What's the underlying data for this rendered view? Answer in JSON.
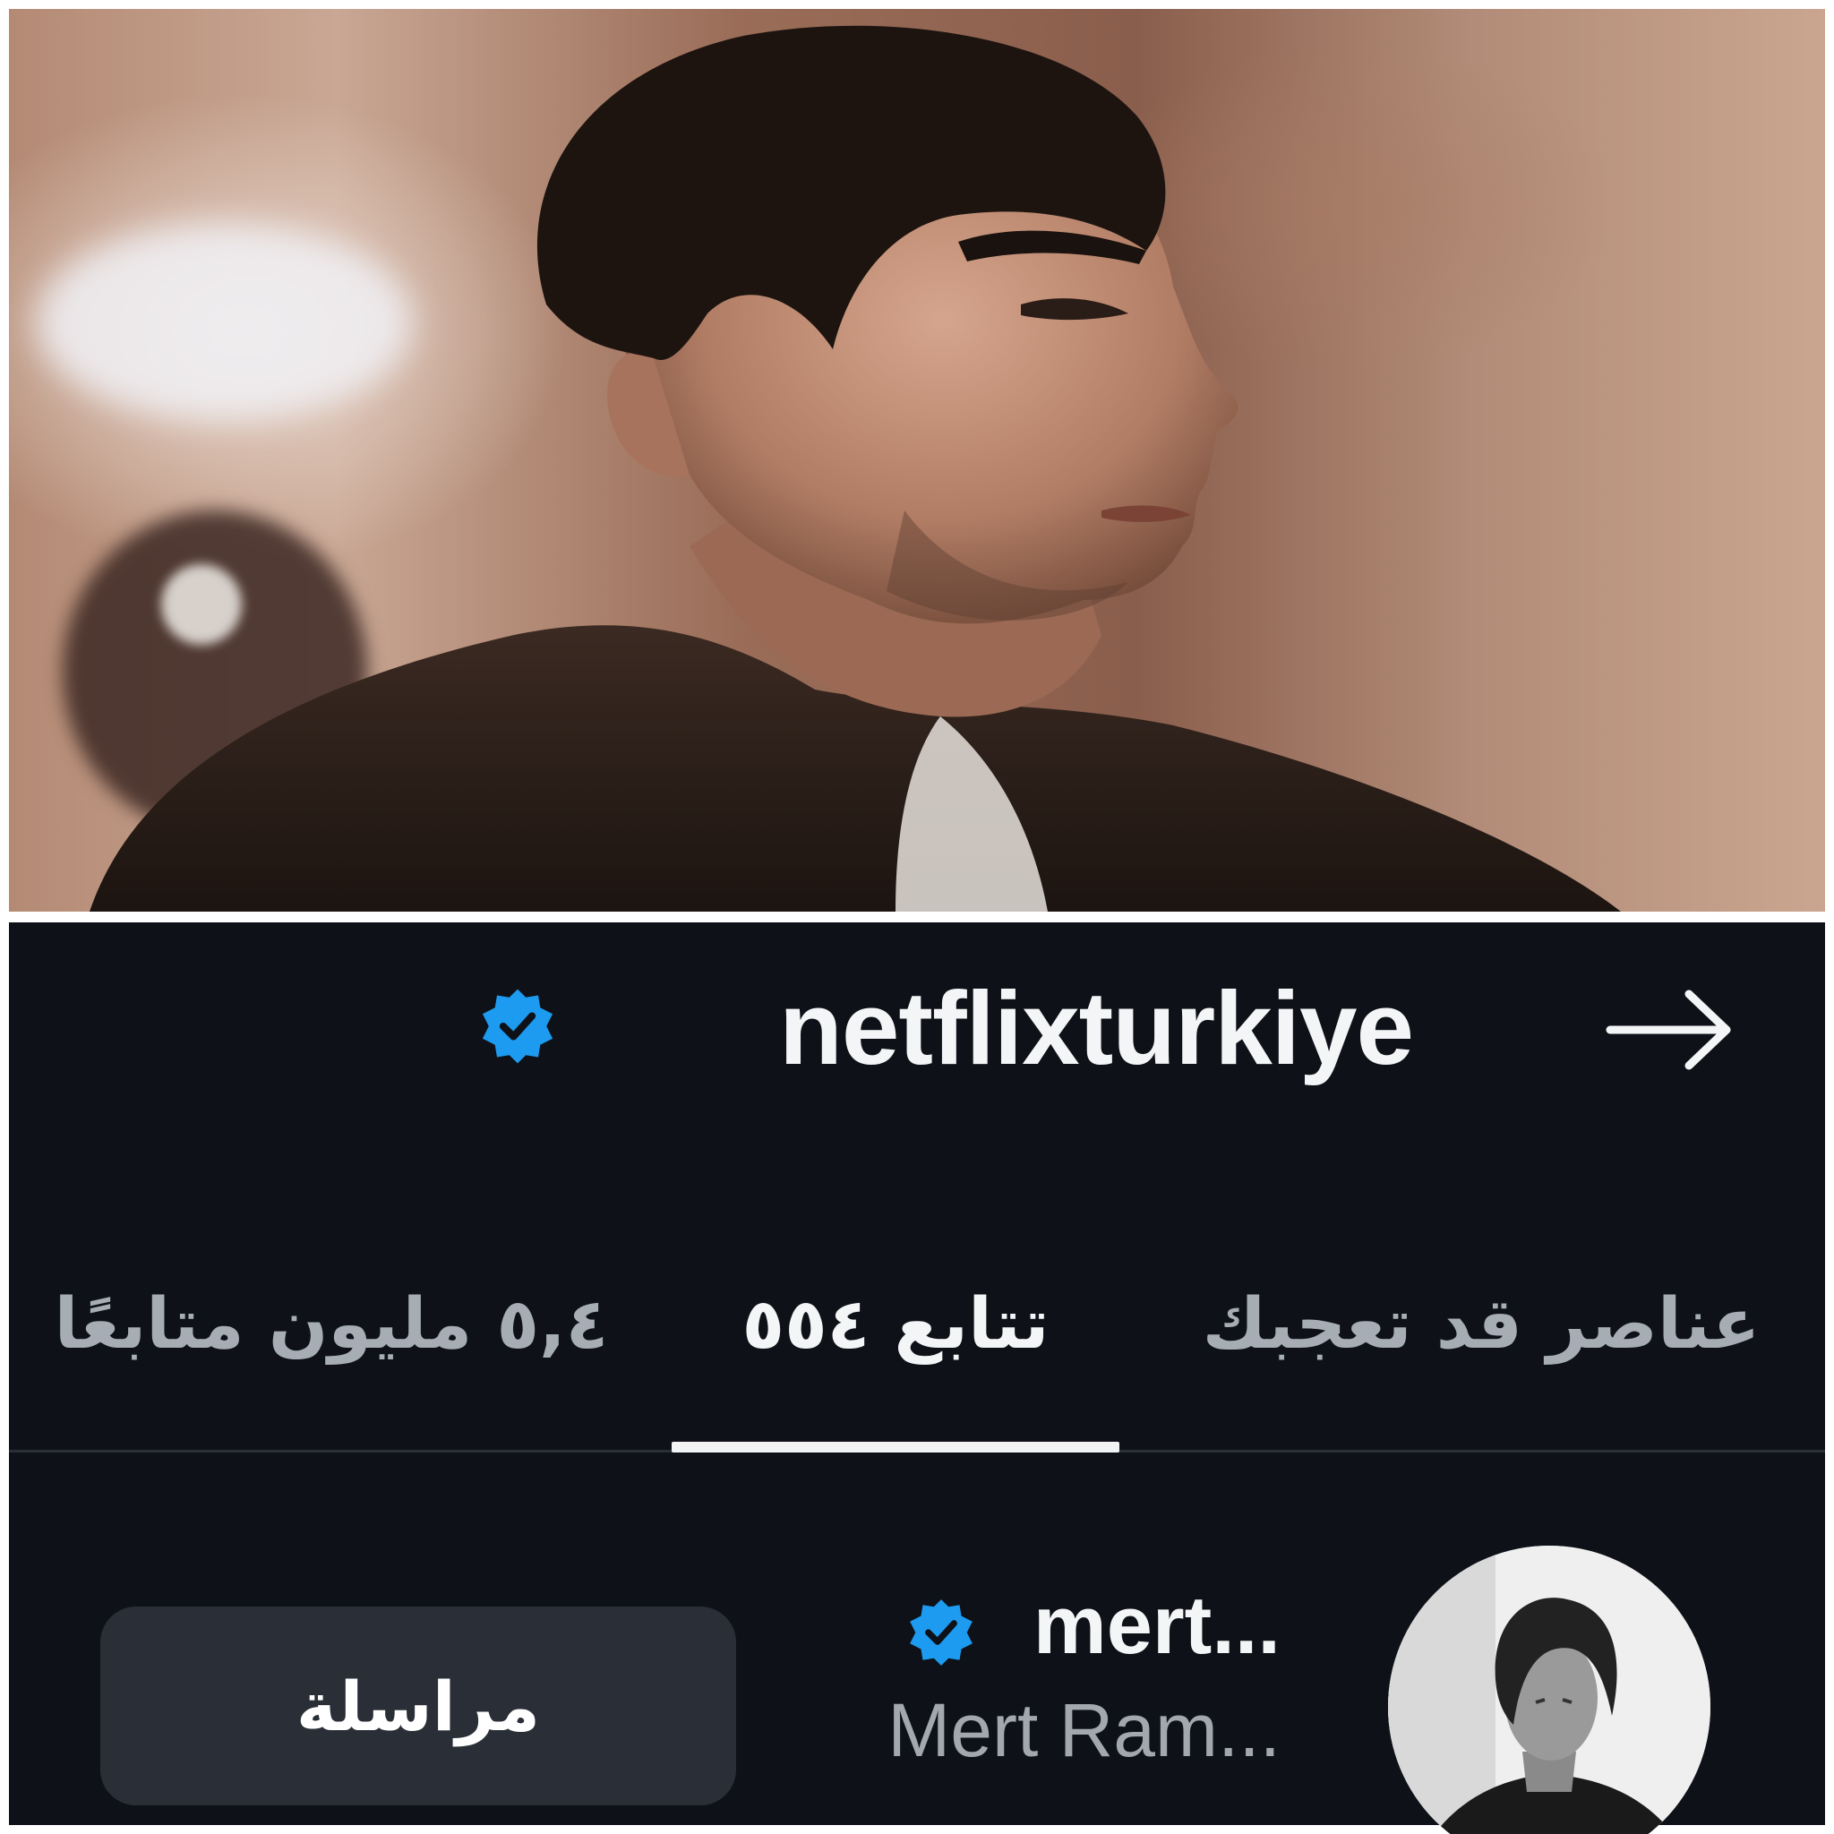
{
  "profile": {
    "username": "netflixturkiye",
    "verified": true,
    "back_icon": "arrow-right-icon"
  },
  "tabs": [
    {
      "label": "٥,٤ مليون متابعًا",
      "active": false
    },
    {
      "label": "تتابع ٥٥٤",
      "active": true
    },
    {
      "label": "عناصر قد تعجبك",
      "active": false
    }
  ],
  "following_row": {
    "handle": "mert...",
    "display_name": "Mert Ram...",
    "verified": true,
    "button_label": "مراسلة"
  },
  "colors": {
    "panel_bg": "#0e1218",
    "verified_blue": "#1d9bf0",
    "button_bg": "#2a2f37",
    "muted_text": "#a7adb5"
  }
}
